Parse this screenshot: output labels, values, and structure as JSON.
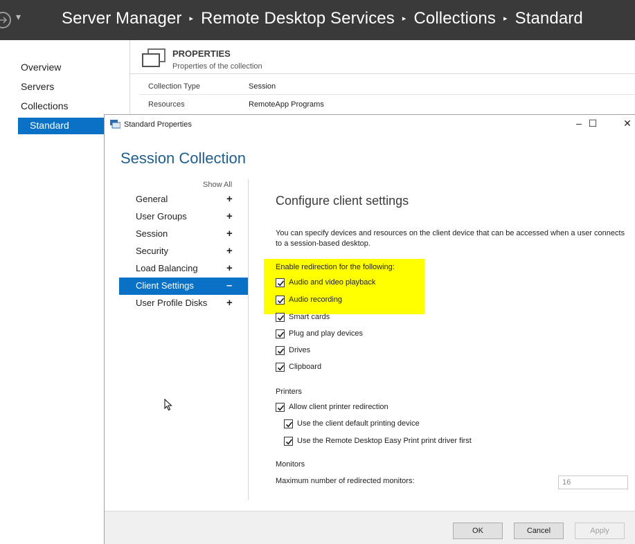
{
  "server_manager": {
    "breadcrumb": [
      "Server Manager",
      "Remote Desktop Services",
      "Collections",
      "Standard"
    ],
    "nav": [
      "Overview",
      "Servers",
      "Collections",
      "Standard"
    ],
    "selected_nav": "Standard",
    "properties": {
      "title": "PROPERTIES",
      "subtitle": "Properties of the collection",
      "rows": [
        {
          "key": "Collection Type",
          "value": "Session"
        },
        {
          "key": "Resources",
          "value": "RemoteApp Programs"
        }
      ]
    }
  },
  "dialog": {
    "title": "Standard Properties",
    "controls": {
      "minimize": "–",
      "maximize": "☐",
      "close": "✕"
    },
    "heading": "Session Collection",
    "show_all": "Show All",
    "tabs": [
      {
        "label": "General",
        "sign": "+"
      },
      {
        "label": "User Groups",
        "sign": "+"
      },
      {
        "label": "Session",
        "sign": "+"
      },
      {
        "label": "Security",
        "sign": "+"
      },
      {
        "label": "Load Balancing",
        "sign": "+"
      },
      {
        "label": "Client Settings",
        "sign": "–"
      },
      {
        "label": "User Profile Disks",
        "sign": "+"
      }
    ],
    "selected_tab": "Client Settings",
    "content": {
      "heading": "Configure client settings",
      "description": "You can specify devices and resources on the client device that can be accessed when a user connects to a session-based desktop.",
      "redirection_label": "Enable redirection for the following:",
      "redirection_items": [
        {
          "label": "Audio and video playback",
          "checked": true
        },
        {
          "label": "Audio recording",
          "checked": true
        },
        {
          "label": "Smart cards",
          "checked": true
        },
        {
          "label": "Plug and play devices",
          "checked": true
        },
        {
          "label": "Drives",
          "checked": true
        },
        {
          "label": "Clipboard",
          "checked": true
        }
      ],
      "printers_label": "Printers",
      "printer_items": [
        {
          "label": "Allow client printer redirection",
          "checked": true
        },
        {
          "label": "Use the client default printing device",
          "checked": true
        },
        {
          "label": "Use the Remote Desktop Easy Print print driver first",
          "checked": true
        }
      ],
      "monitors_label": "Monitors",
      "max_monitors_label": "Maximum number of redirected monitors:",
      "max_monitors_value": "16"
    },
    "buttons": {
      "ok": "OK",
      "cancel": "Cancel",
      "apply": "Apply"
    },
    "highlight_color": "#ffff00",
    "accent_color": "#0a72c6"
  }
}
